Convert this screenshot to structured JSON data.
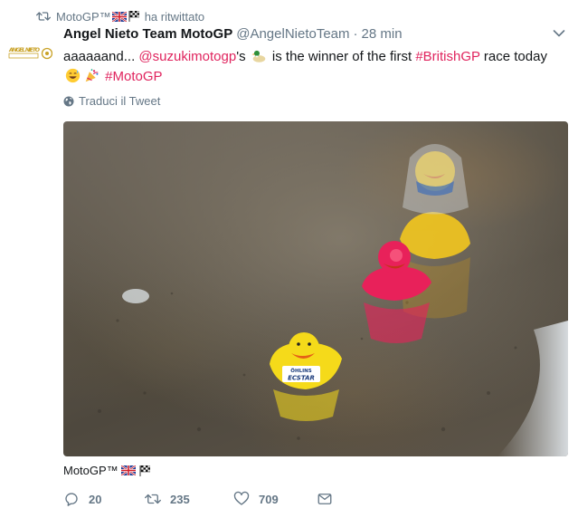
{
  "retweet": {
    "account": "MotoGP™",
    "label": "ha ritwittato"
  },
  "tweet": {
    "name": "Angel Nieto Team MotoGP",
    "handle": "@AngelNietoTeam",
    "separator": "·",
    "time": "28 min",
    "text_1": "aaaaaand... ",
    "mention": "@suzukimotogp",
    "text_2": "'s ",
    "text_3": " is the winner of the first ",
    "hashtag_1": "#BritishGP",
    "text_4": " race today",
    "hashtag_2": "#MotoGP",
    "translate": "Traduci il Tweet",
    "avatar_text": "ANGEL NIETO"
  },
  "photo": {
    "duck_label_top": "ÖHLINS",
    "duck_label_bottom": "ECSTAR"
  },
  "media_source": "MotoGP™",
  "actions": {
    "replies": "20",
    "retweets": "235",
    "likes": "709"
  },
  "colors": {
    "link": "#e0245e",
    "muted": "#657786",
    "text": "#14171a"
  }
}
